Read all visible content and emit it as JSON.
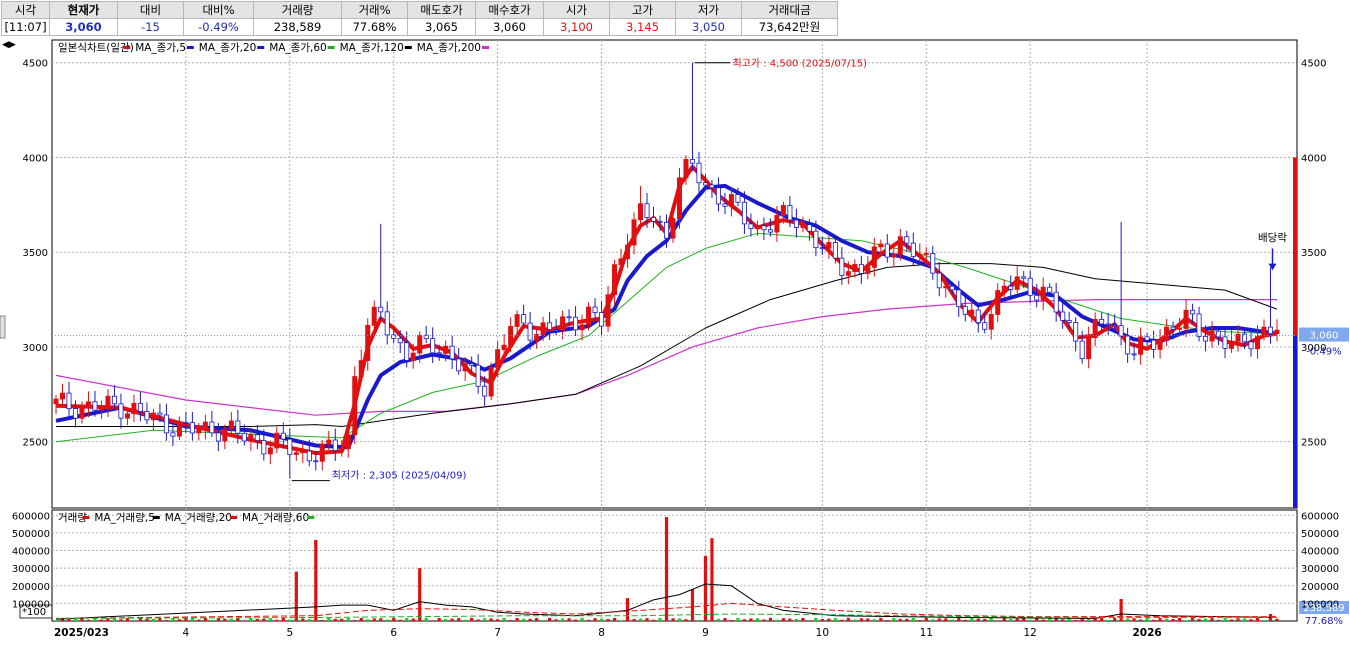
{
  "quote": {
    "headers": [
      "시각",
      "현재가",
      "대비",
      "대비%",
      "거래량",
      "거래%",
      "매도호가",
      "매수호가",
      "시가",
      "고가",
      "저가",
      "거래대금"
    ],
    "values": [
      "[11:07]",
      "3,060",
      "-15",
      "-0.49%",
      "238,589",
      "77.68%",
      "3,065",
      "3,060",
      "3,100",
      "3,145",
      "3,050",
      "73,642만원"
    ]
  },
  "toggle_icon": "◀▶",
  "price_legend": [
    {
      "text": "일본식차트(일간)",
      "color": "#d01010"
    },
    {
      "text": "MA_종가,5",
      "color": "#1a1acc"
    },
    {
      "text": "MA_종가,20",
      "color": "#1a1acc"
    },
    {
      "text": "MA_종가,60",
      "color": "#22b022"
    },
    {
      "text": "MA_종가,120",
      "color": "#000000"
    },
    {
      "text": "MA_종가,200",
      "color": "#cc33cc"
    }
  ],
  "volume_legend": [
    {
      "text": "거래량",
      "color": "#d01010"
    },
    {
      "text": "MA_거래량,5",
      "color": "#000000"
    },
    {
      "text": "MA_거래량,20",
      "color": "#d01010"
    },
    {
      "text": "MA_거래량,60",
      "color": "#22b022"
    }
  ],
  "annotations": {
    "high": "최고가 : 4,500 (2025/07/15)",
    "low": "최저가 : 2,305 (2025/04/09)",
    "dividend": "배당락"
  },
  "current_price_tag": "3,060",
  "current_change_tag": "-0.49%",
  "current_volume_tag": "238,589",
  "current_volume_pct": "77.68%",
  "volume_unit": "*100",
  "x_labels": [
    "2025/023",
    "4",
    "5",
    "6",
    "7",
    "8",
    "9",
    "10",
    "11",
    "12",
    "2026"
  ],
  "chart_data": {
    "type": "candlestick",
    "price_axis": {
      "ticks": [
        2500,
        3000,
        3500,
        4000,
        4500
      ],
      "range": [
        2150,
        4620
      ]
    },
    "volume_axis": {
      "ticks": [
        100000,
        200000,
        300000,
        400000,
        500000,
        600000
      ],
      "range": [
        0,
        630000
      ]
    },
    "high": 4500,
    "low": 2305,
    "current": 3060,
    "price_path": [
      [
        0,
        2700
      ],
      [
        5,
        2680
      ],
      [
        10,
        2690
      ],
      [
        15,
        2620
      ],
      [
        20,
        2560
      ],
      [
        25,
        2570
      ],
      [
        28,
        2540
      ],
      [
        31,
        2500
      ],
      [
        35,
        2480
      ],
      [
        38,
        2430
      ],
      [
        42,
        2450
      ],
      [
        45,
        2520
      ],
      [
        46,
        2850
      ],
      [
        48,
        3100
      ],
      [
        50,
        3180
      ],
      [
        52,
        3050
      ],
      [
        54,
        2960
      ],
      [
        56,
        3000
      ],
      [
        58,
        3020
      ],
      [
        60,
        2980
      ],
      [
        62,
        2900
      ],
      [
        64,
        2850
      ],
      [
        66,
        2800
      ],
      [
        68,
        2960
      ],
      [
        70,
        3100
      ],
      [
        72,
        3130
      ],
      [
        74,
        3080
      ],
      [
        76,
        3090
      ],
      [
        78,
        3120
      ],
      [
        80,
        3150
      ],
      [
        82,
        3170
      ],
      [
        84,
        3130
      ],
      [
        86,
        3400
      ],
      [
        88,
        3600
      ],
      [
        90,
        3700
      ],
      [
        92,
        3680
      ],
      [
        94,
        3580
      ],
      [
        96,
        3900
      ],
      [
        98,
        3950
      ],
      [
        100,
        3850
      ],
      [
        102,
        3800
      ],
      [
        104,
        3750
      ],
      [
        106,
        3680
      ],
      [
        108,
        3620
      ],
      [
        110,
        3650
      ],
      [
        112,
        3680
      ],
      [
        114,
        3680
      ],
      [
        116,
        3600
      ],
      [
        118,
        3520
      ],
      [
        120,
        3450
      ],
      [
        122,
        3420
      ],
      [
        124,
        3400
      ],
      [
        126,
        3480
      ],
      [
        128,
        3520
      ],
      [
        130,
        3560
      ],
      [
        132,
        3500
      ],
      [
        134,
        3440
      ],
      [
        136,
        3380
      ],
      [
        138,
        3260
      ],
      [
        140,
        3180
      ],
      [
        142,
        3120
      ],
      [
        144,
        3200
      ],
      [
        146,
        3300
      ],
      [
        148,
        3350
      ],
      [
        150,
        3320
      ],
      [
        152,
        3280
      ],
      [
        154,
        3200
      ],
      [
        156,
        3100
      ],
      [
        158,
        3000
      ],
      [
        160,
        3080
      ],
      [
        162,
        3150
      ],
      [
        164,
        3050
      ],
      [
        166,
        2980
      ],
      [
        168,
        3000
      ],
      [
        170,
        3050
      ],
      [
        172,
        3120
      ],
      [
        174,
        3150
      ],
      [
        176,
        3080
      ],
      [
        178,
        3070
      ],
      [
        180,
        3030
      ],
      [
        182,
        3000
      ],
      [
        184,
        3050
      ],
      [
        186,
        3080
      ],
      [
        188,
        3100
      ]
    ],
    "ma_paths": {
      "ma5": [
        [
          0,
          2690
        ],
        [
          10,
          2680
        ],
        [
          20,
          2590
        ],
        [
          30,
          2510
        ],
        [
          40,
          2440
        ],
        [
          44,
          2450
        ],
        [
          46,
          2700
        ],
        [
          48,
          3000
        ],
        [
          50,
          3150
        ],
        [
          52,
          3100
        ],
        [
          55,
          2990
        ],
        [
          58,
          3010
        ],
        [
          61,
          2970
        ],
        [
          64,
          2860
        ],
        [
          67,
          2810
        ],
        [
          69,
          2950
        ],
        [
          72,
          3110
        ],
        [
          76,
          3090
        ],
        [
          80,
          3130
        ],
        [
          84,
          3150
        ],
        [
          86,
          3300
        ],
        [
          88,
          3520
        ],
        [
          90,
          3640
        ],
        [
          92,
          3680
        ],
        [
          94,
          3600
        ],
        [
          96,
          3850
        ],
        [
          98,
          3950
        ],
        [
          100,
          3880
        ],
        [
          102,
          3800
        ],
        [
          105,
          3720
        ],
        [
          108,
          3630
        ],
        [
          112,
          3670
        ],
        [
          115,
          3650
        ],
        [
          118,
          3540
        ],
        [
          121,
          3440
        ],
        [
          124,
          3400
        ],
        [
          127,
          3490
        ],
        [
          130,
          3560
        ],
        [
          133,
          3480
        ],
        [
          136,
          3390
        ],
        [
          139,
          3230
        ],
        [
          142,
          3130
        ],
        [
          145,
          3260
        ],
        [
          148,
          3350
        ],
        [
          151,
          3300
        ],
        [
          154,
          3200
        ],
        [
          157,
          3050
        ],
        [
          160,
          3060
        ],
        [
          163,
          3120
        ],
        [
          165,
          3020
        ],
        [
          168,
          2990
        ],
        [
          171,
          3060
        ],
        [
          174,
          3150
        ],
        [
          177,
          3080
        ],
        [
          180,
          3030
        ],
        [
          183,
          3010
        ],
        [
          186,
          3060
        ],
        [
          188,
          3070
        ]
      ],
      "ma20": [
        [
          0,
          2610
        ],
        [
          10,
          2680
        ],
        [
          20,
          2580
        ],
        [
          30,
          2560
        ],
        [
          40,
          2480
        ],
        [
          45,
          2470
        ],
        [
          48,
          2720
        ],
        [
          50,
          2850
        ],
        [
          53,
          2920
        ],
        [
          58,
          2960
        ],
        [
          63,
          2930
        ],
        [
          66,
          2880
        ],
        [
          70,
          2940
        ],
        [
          76,
          3080
        ],
        [
          82,
          3110
        ],
        [
          86,
          3200
        ],
        [
          88,
          3350
        ],
        [
          91,
          3480
        ],
        [
          94,
          3560
        ],
        [
          97,
          3720
        ],
        [
          100,
          3840
        ],
        [
          103,
          3850
        ],
        [
          108,
          3760
        ],
        [
          113,
          3680
        ],
        [
          117,
          3640
        ],
        [
          121,
          3560
        ],
        [
          125,
          3500
        ],
        [
          130,
          3480
        ],
        [
          135,
          3420
        ],
        [
          139,
          3300
        ],
        [
          142,
          3220
        ],
        [
          146,
          3250
        ],
        [
          150,
          3290
        ],
        [
          154,
          3270
        ],
        [
          158,
          3160
        ],
        [
          162,
          3100
        ],
        [
          166,
          3040
        ],
        [
          170,
          3030
        ],
        [
          174,
          3080
        ],
        [
          178,
          3100
        ],
        [
          182,
          3100
        ],
        [
          186,
          3080
        ],
        [
          188,
          3070
        ]
      ],
      "ma60": [
        [
          0,
          2500
        ],
        [
          15,
          2560
        ],
        [
          30,
          2540
        ],
        [
          44,
          2520
        ],
        [
          50,
          2650
        ],
        [
          58,
          2760
        ],
        [
          66,
          2820
        ],
        [
          74,
          2950
        ],
        [
          82,
          3060
        ],
        [
          88,
          3240
        ],
        [
          94,
          3420
        ],
        [
          100,
          3520
        ],
        [
          108,
          3600
        ],
        [
          116,
          3580
        ],
        [
          124,
          3560
        ],
        [
          132,
          3500
        ],
        [
          140,
          3420
        ],
        [
          148,
          3330
        ],
        [
          156,
          3240
        ],
        [
          164,
          3150
        ],
        [
          172,
          3110
        ],
        [
          180,
          3080
        ],
        [
          188,
          3070
        ]
      ],
      "ma120": [
        [
          0,
          2580
        ],
        [
          15,
          2580
        ],
        [
          30,
          2580
        ],
        [
          40,
          2590
        ],
        [
          44,
          2580
        ],
        [
          48,
          2600
        ],
        [
          58,
          2650
        ],
        [
          70,
          2700
        ],
        [
          80,
          2750
        ],
        [
          90,
          2900
        ],
        [
          100,
          3100
        ],
        [
          110,
          3250
        ],
        [
          120,
          3350
        ],
        [
          128,
          3420
        ],
        [
          136,
          3440
        ],
        [
          144,
          3440
        ],
        [
          152,
          3420
        ],
        [
          160,
          3360
        ],
        [
          170,
          3330
        ],
        [
          180,
          3300
        ],
        [
          188,
          3200
        ]
      ],
      "ma200": [
        [
          0,
          2850
        ],
        [
          20,
          2720
        ],
        [
          30,
          2680
        ],
        [
          40,
          2640
        ],
        [
          50,
          2660
        ],
        [
          60,
          2660
        ],
        [
          70,
          2700
        ],
        [
          80,
          2750
        ],
        [
          88,
          2850
        ],
        [
          98,
          3000
        ],
        [
          108,
          3100
        ],
        [
          118,
          3160
        ],
        [
          128,
          3200
        ],
        [
          140,
          3230
        ],
        [
          150,
          3240
        ],
        [
          160,
          3250
        ],
        [
          170,
          3250
        ],
        [
          180,
          3250
        ],
        [
          188,
          3250
        ]
      ]
    },
    "volume_spikes": [
      [
        37,
        280000
      ],
      [
        40,
        460000
      ],
      [
        56,
        300000
      ],
      [
        88,
        130000
      ],
      [
        94,
        590000
      ],
      [
        98,
        180000
      ],
      [
        100,
        370000
      ],
      [
        101,
        470000
      ],
      [
        164,
        125000
      ],
      [
        187,
        40000
      ]
    ],
    "vol_ma5": [
      [
        0,
        10000
      ],
      [
        40,
        80000
      ],
      [
        44,
        90000
      ],
      [
        48,
        90000
      ],
      [
        52,
        60000
      ],
      [
        56,
        110000
      ],
      [
        60,
        90000
      ],
      [
        64,
        80000
      ],
      [
        68,
        50000
      ],
      [
        72,
        40000
      ],
      [
        80,
        30000
      ],
      [
        88,
        60000
      ],
      [
        92,
        120000
      ],
      [
        96,
        150000
      ],
      [
        100,
        210000
      ],
      [
        104,
        200000
      ],
      [
        108,
        100000
      ],
      [
        112,
        60000
      ],
      [
        120,
        30000
      ],
      [
        140,
        20000
      ],
      [
        160,
        15000
      ],
      [
        164,
        40000
      ],
      [
        170,
        30000
      ],
      [
        188,
        20000
      ]
    ],
    "vol_ma20": [
      [
        0,
        15000
      ],
      [
        40,
        30000
      ],
      [
        48,
        60000
      ],
      [
        56,
        70000
      ],
      [
        64,
        65000
      ],
      [
        72,
        50000
      ],
      [
        80,
        40000
      ],
      [
        90,
        60000
      ],
      [
        98,
        80000
      ],
      [
        104,
        100000
      ],
      [
        112,
        80000
      ],
      [
        120,
        60000
      ],
      [
        130,
        40000
      ],
      [
        140,
        30000
      ],
      [
        150,
        25000
      ],
      [
        160,
        25000
      ],
      [
        170,
        25000
      ],
      [
        188,
        25000
      ]
    ],
    "vol_ma60": [
      [
        0,
        15000
      ],
      [
        40,
        20000
      ],
      [
        56,
        25000
      ],
      [
        72,
        30000
      ],
      [
        90,
        30000
      ],
      [
        104,
        40000
      ],
      [
        120,
        35000
      ],
      [
        140,
        25000
      ],
      [
        160,
        20000
      ],
      [
        188,
        20000
      ]
    ]
  }
}
